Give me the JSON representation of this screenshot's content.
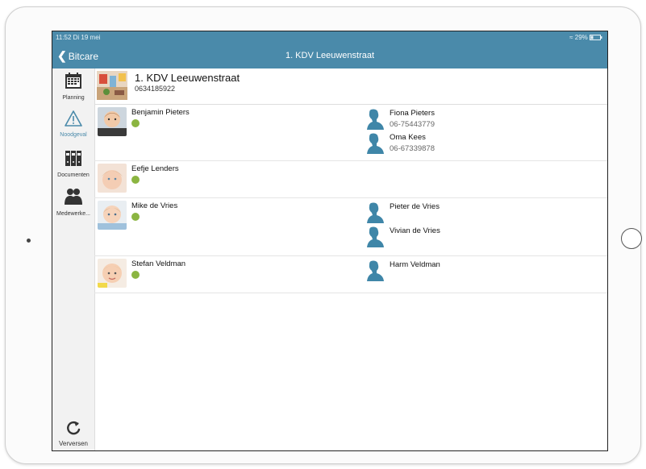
{
  "status": {
    "time": "11:52  Di 19 mei",
    "battery": "29%"
  },
  "nav": {
    "back_label": "Bitcare",
    "title": "1. KDV Leeuwenstraat"
  },
  "sidebar": {
    "items": [
      {
        "label": "Planning",
        "icon": "calendar-icon"
      },
      {
        "label": "Noodgeval",
        "icon": "warning-icon"
      },
      {
        "label": "Documenten",
        "icon": "binders-icon"
      },
      {
        "label": "Medewerke...",
        "icon": "people-icon"
      }
    ],
    "refresh_label": "Verversen"
  },
  "center": {
    "name": "1. KDV Leeuwenstraat",
    "phone": "0634185922"
  },
  "children": [
    {
      "name": "Benjamin Pieters",
      "contacts": [
        {
          "name": "Fiona Pieters",
          "phone": "06-75443779"
        },
        {
          "name": "Oma Kees",
          "phone": "06-67339878"
        }
      ]
    },
    {
      "name": "Eefje Lenders",
      "contacts": []
    },
    {
      "name": "Mike de Vries",
      "contacts": [
        {
          "name": "Pieter de Vries",
          "phone": ""
        },
        {
          "name": "Vivian de Vries",
          "phone": ""
        }
      ]
    },
    {
      "name": "Stefan Veldman",
      "contacts": [
        {
          "name": "Harm Veldman",
          "phone": ""
        }
      ]
    }
  ],
  "colors": {
    "accent": "#4a8aaa",
    "status_dot": "#8bb541",
    "contact_icon": "#3f86a8"
  }
}
